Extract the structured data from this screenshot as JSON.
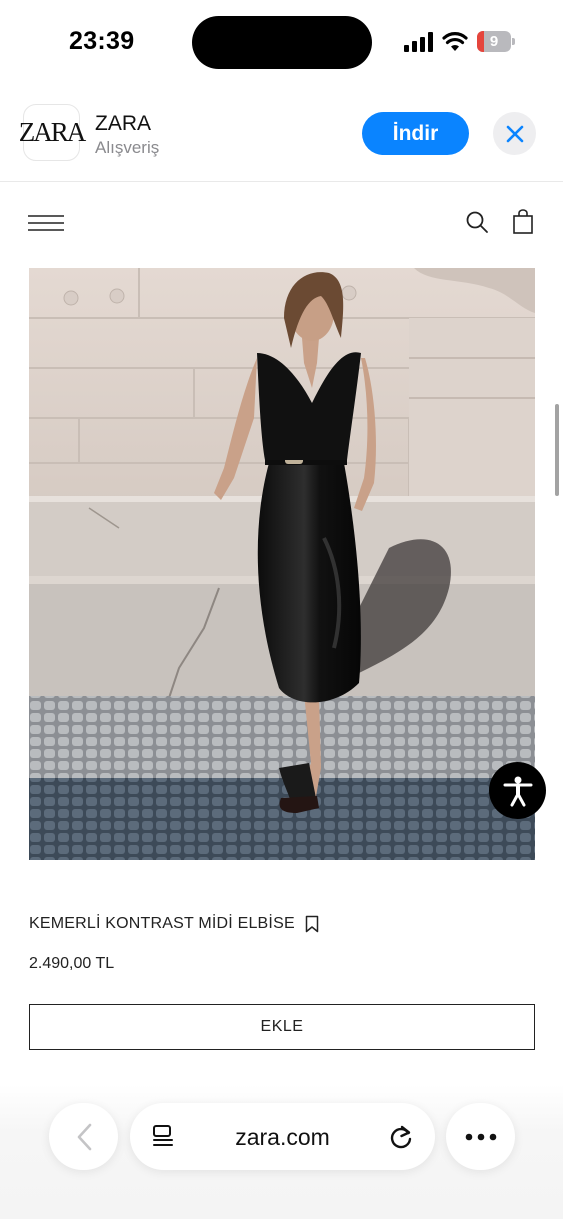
{
  "status_bar": {
    "time": "23:39",
    "battery_level": "9",
    "battery_fraction": 0.09
  },
  "app_banner": {
    "logo_text": "ZARA",
    "app_name": "ZARA",
    "category": "Alışveriş",
    "install_label": "İndir"
  },
  "site_nav": {
    "icons": [
      "menu-icon",
      "search-icon",
      "shopping-bag-icon"
    ]
  },
  "product": {
    "image_alt": "product-photo",
    "title": "KEMERLİ KONTRAST MİDİ ELBİSE",
    "price": "2.490,00 TL",
    "add_label": "EKLE"
  },
  "browser_toolbar": {
    "url": "zara.com",
    "icons": [
      "back-chevron-icon",
      "reader-icon",
      "reload-icon",
      "more-icon"
    ]
  },
  "colors": {
    "install_button": "#0a84ff",
    "battery_low": "#e5453c",
    "text": "#1a1a1a"
  }
}
